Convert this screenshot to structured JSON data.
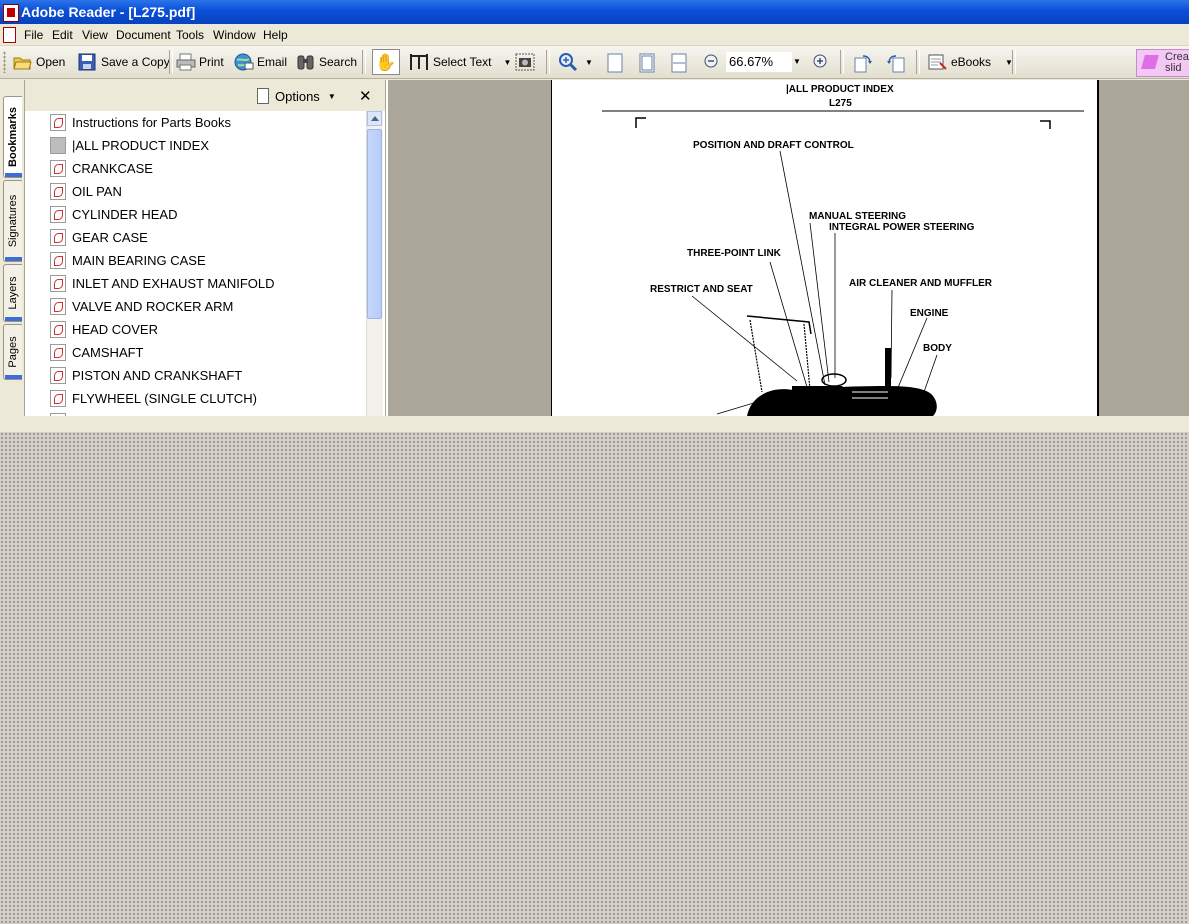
{
  "window": {
    "title": "Adobe Reader - [L275.pdf]"
  },
  "menu": [
    "File",
    "Edit",
    "View",
    "Document",
    "Tools",
    "Window",
    "Help"
  ],
  "toolbar": {
    "open": "Open",
    "save_copy": "Save a Copy",
    "print": "Print",
    "email": "Email",
    "search": "Search",
    "select_text": "Select Text",
    "zoom": "66.67%",
    "ebooks": "eBooks",
    "create_slide": "Crea slid"
  },
  "nav_tabs": [
    "Bookmarks",
    "Signatures",
    "Layers",
    "Pages"
  ],
  "bookmarks_panel": {
    "options_label": "Options",
    "items": [
      "Instructions for Parts Books",
      "|ALL PRODUCT INDEX",
      "CRANKCASE",
      "OIL PAN",
      "CYLINDER HEAD",
      "GEAR CASE",
      "MAIN BEARING CASE",
      "INLET AND EXHAUST MANIFOLD",
      "VALVE AND ROCKER ARM",
      "HEAD COVER",
      "CAMSHAFT",
      "PISTON AND CRANKSHAFT",
      "FLYWHEEL (SINGLE CLUTCH)"
    ]
  },
  "document": {
    "header_title": "|ALL PRODUCT INDEX",
    "header_model": "L275",
    "callouts": {
      "position_draft": "POSITION AND DRAFT CONTROL",
      "manual_steering": "MANUAL STEERING",
      "integral_power_steering": "INTEGRAL POWER STEERING",
      "three_point_link": "THREE-POINT LINK",
      "air_cleaner_muffler": "AIR CLEANER AND MUFFLER",
      "restrict_seat": "RESTRICT AND SEAT",
      "engine": "ENGINE",
      "body": "BODY"
    }
  },
  "colors": {
    "titlebar": "#0a4fd8",
    "chrome": "#ece9d8",
    "doc_background": "#aaa69a",
    "pdf_red": "#d42b2b"
  }
}
